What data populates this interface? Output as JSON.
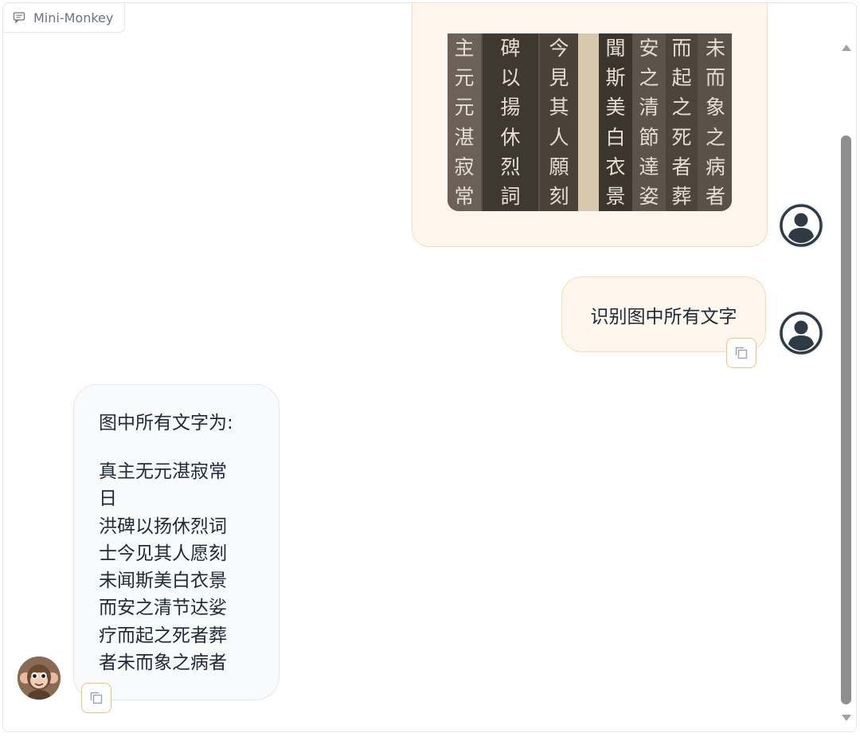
{
  "app": {
    "label": "Mini-Monkey",
    "label_icon": "chat-icon"
  },
  "user_image": {
    "description_icon": "stele-rubbing-image",
    "columns": [
      {
        "chars": "主元元湛寂常"
      },
      {
        "chars": "碑以揚休烈詞"
      },
      {
        "chars": "今見其人願刻"
      },
      {
        "chars": "聞斯美白衣景"
      },
      {
        "chars": "安之清節達姿"
      },
      {
        "chars": "而起之死者葬"
      },
      {
        "chars": "未而象之病者"
      }
    ]
  },
  "user_message": {
    "text": "识别图中所有文字",
    "copy_icon": "copy-icon"
  },
  "bot_message": {
    "intro": "图中所有文字为:",
    "lines": [
      "真主无元湛寂常",
      "日",
      "洪碑以扬休烈词",
      "士今见其人愿刻",
      "未闻斯美白衣景",
      "而安之清节达娑",
      "疗而起之死者葬",
      "者未而象之病者"
    ],
    "copy_icon": "copy-icon"
  },
  "colors": {
    "user_bubble_bg": "#fff7ed",
    "user_bubble_border": "#fcd9b0",
    "copy_border": "#fdba74",
    "bot_bubble_bg": "#f9fafb",
    "scroll_thumb": "#8f8f8f"
  }
}
